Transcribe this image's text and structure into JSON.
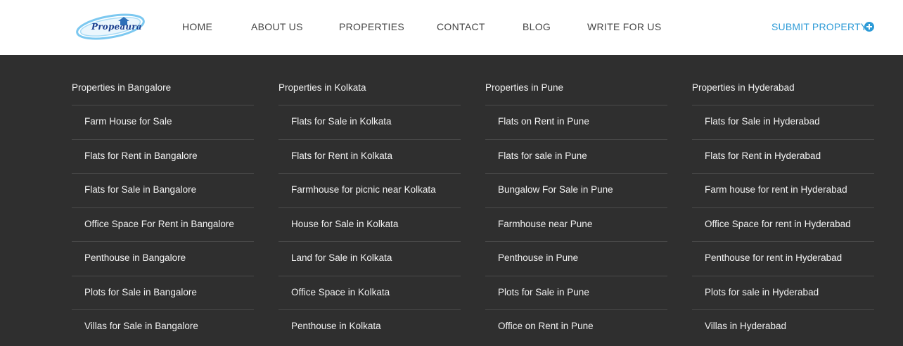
{
  "header": {
    "logo_text": "Propeaura",
    "nav": [
      "HOME",
      "ABOUT US",
      "PROPERTIES",
      "CONTACT",
      "BLOG",
      "WRITE FOR US"
    ],
    "submit_label": "SUBMIT PROPERTY",
    "submit_icon": "plus-circle-icon"
  },
  "colors": {
    "accent": "#2d9bd7",
    "menu_bg": "#2f2f2f",
    "header_bg": "#ffffff"
  },
  "menu": {
    "columns": [
      {
        "title": "Properties in Bangalore",
        "links": [
          "Farm House for Sale",
          "Flats for Rent in Bangalore",
          "Flats for Sale in Bangalore",
          "Office Space For Rent in Bangalore",
          "Penthouse in Bangalore",
          "Plots for Sale in Bangalore",
          "Villas for Sale in Bangalore"
        ]
      },
      {
        "title": "Properties in Kolkata",
        "links": [
          "Flats for Sale in Kolkata",
          "Flats for Rent in Kolkata",
          "Farmhouse for picnic near Kolkata",
          "House for Sale in Kolkata",
          "Land for Sale in Kolkata",
          "Office Space in Kolkata",
          "Penthouse in Kolkata"
        ]
      },
      {
        "title": "Properties in Pune",
        "links": [
          "Flats on Rent in Pune",
          "Flats for sale in Pune",
          "Bungalow For Sale in Pune",
          "Farmhouse near Pune",
          "Penthouse in Pune",
          "Plots for Sale in Pune",
          "Office on Rent in Pune"
        ]
      },
      {
        "title": "Properties in Hyderabad",
        "links": [
          "Flats for Sale in Hyderabad",
          "Flats for Rent in Hyderabad",
          "Farm house for rent in Hyderabad",
          "Office Space for rent in Hyderabad",
          "Penthouse for rent in Hyderabad",
          "Plots for sale in Hyderabad",
          "Villas in Hyderabad"
        ]
      }
    ]
  }
}
